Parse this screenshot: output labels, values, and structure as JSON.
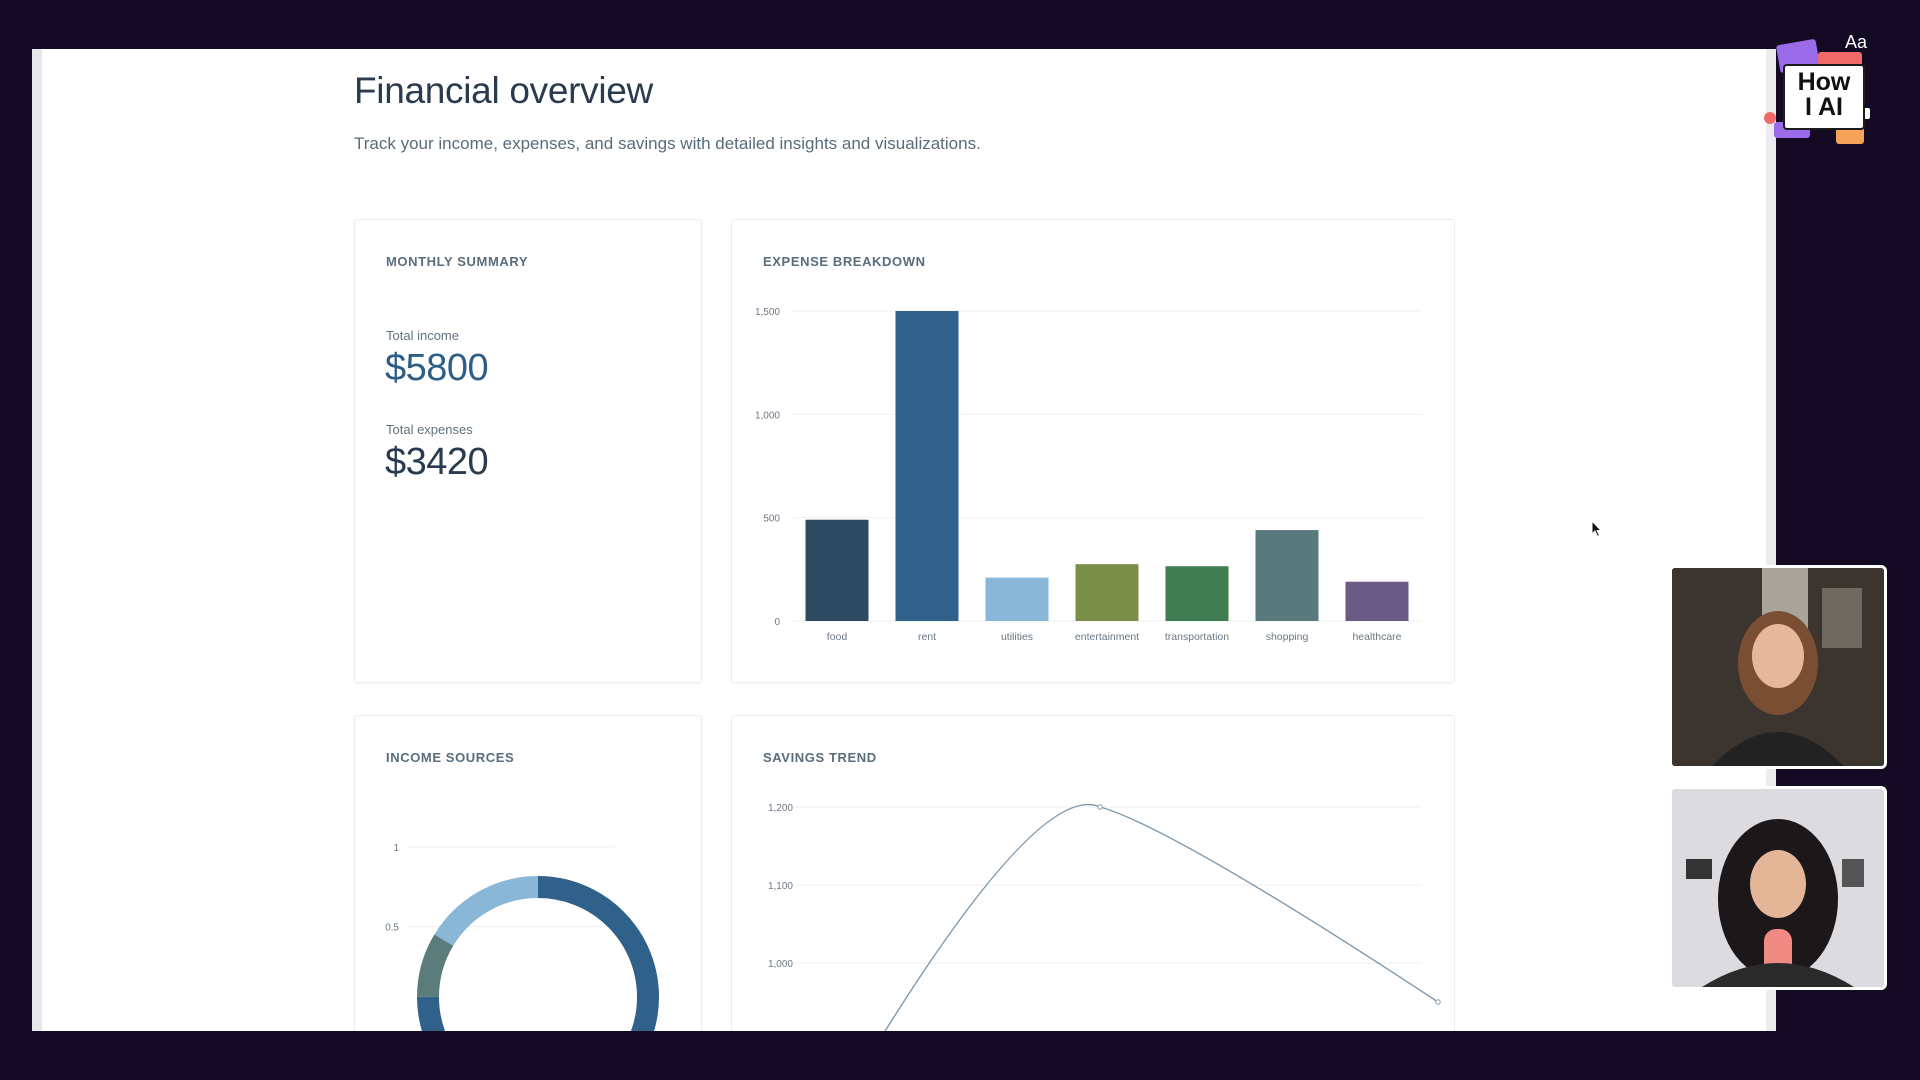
{
  "page": {
    "title": "Financial overview",
    "subtitle": "Track your income, expenses, and savings with detailed insights and visualizations."
  },
  "summary": {
    "title": "MONTHLY SUMMARY",
    "income_label": "Total income",
    "income_value": "$5800",
    "expenses_label": "Total expenses",
    "expenses_value": "$3420"
  },
  "expense_card": {
    "title": "EXPENSE BREAKDOWN"
  },
  "income_card": {
    "title": "INCOME SOURCES"
  },
  "savings_card": {
    "title": "SAVINGS TREND"
  },
  "overlay": {
    "logo_text_line1": "How",
    "logo_text_line2": "I AI",
    "logo_aa": "Aa"
  },
  "colors": {
    "accent": "#2e5e86",
    "text_dark": "#2a3a4f"
  },
  "chart_data": [
    {
      "type": "bar",
      "title": "EXPENSE BREAKDOWN",
      "categories": [
        "food",
        "rent",
        "utilities",
        "entertainment",
        "transportation",
        "shopping",
        "healthcare"
      ],
      "values": [
        490,
        1500,
        210,
        275,
        265,
        440,
        190
      ],
      "colors": [
        "#2d4a63",
        "#30618a",
        "#8ab7d8",
        "#7a8e4a",
        "#3f7d52",
        "#587a7d",
        "#6a5a86"
      ],
      "yticks": [
        0,
        500,
        1000,
        1500
      ],
      "ytick_labels": [
        "0",
        "500",
        "1,000",
        "1,500"
      ],
      "ylim": [
        0,
        1500
      ],
      "grid": true
    },
    {
      "type": "pie",
      "title": "INCOME SOURCES",
      "donut": true,
      "slices": [
        {
          "value": 0.75,
          "color": "#30618a"
        },
        {
          "value": 0.0862,
          "color": "#5a7d7b"
        },
        {
          "value": 0.1638,
          "color": "#8ab7d8"
        }
      ],
      "yticks": [
        0.5,
        1
      ],
      "ytick_labels": [
        "0.5",
        "1"
      ]
    },
    {
      "type": "line",
      "title": "SAVINGS TREND",
      "points": [
        {
          "x": 0,
          "y": 800
        },
        {
          "x": 1,
          "y": 1200
        },
        {
          "x": 2,
          "y": 950
        }
      ],
      "yticks": [
        1000,
        1100,
        1200
      ],
      "ytick_labels": [
        "1,000",
        "1,100",
        "1,200"
      ],
      "ylim": [
        900,
        1200
      ],
      "color": "#7f98ad",
      "grid": true
    }
  ]
}
